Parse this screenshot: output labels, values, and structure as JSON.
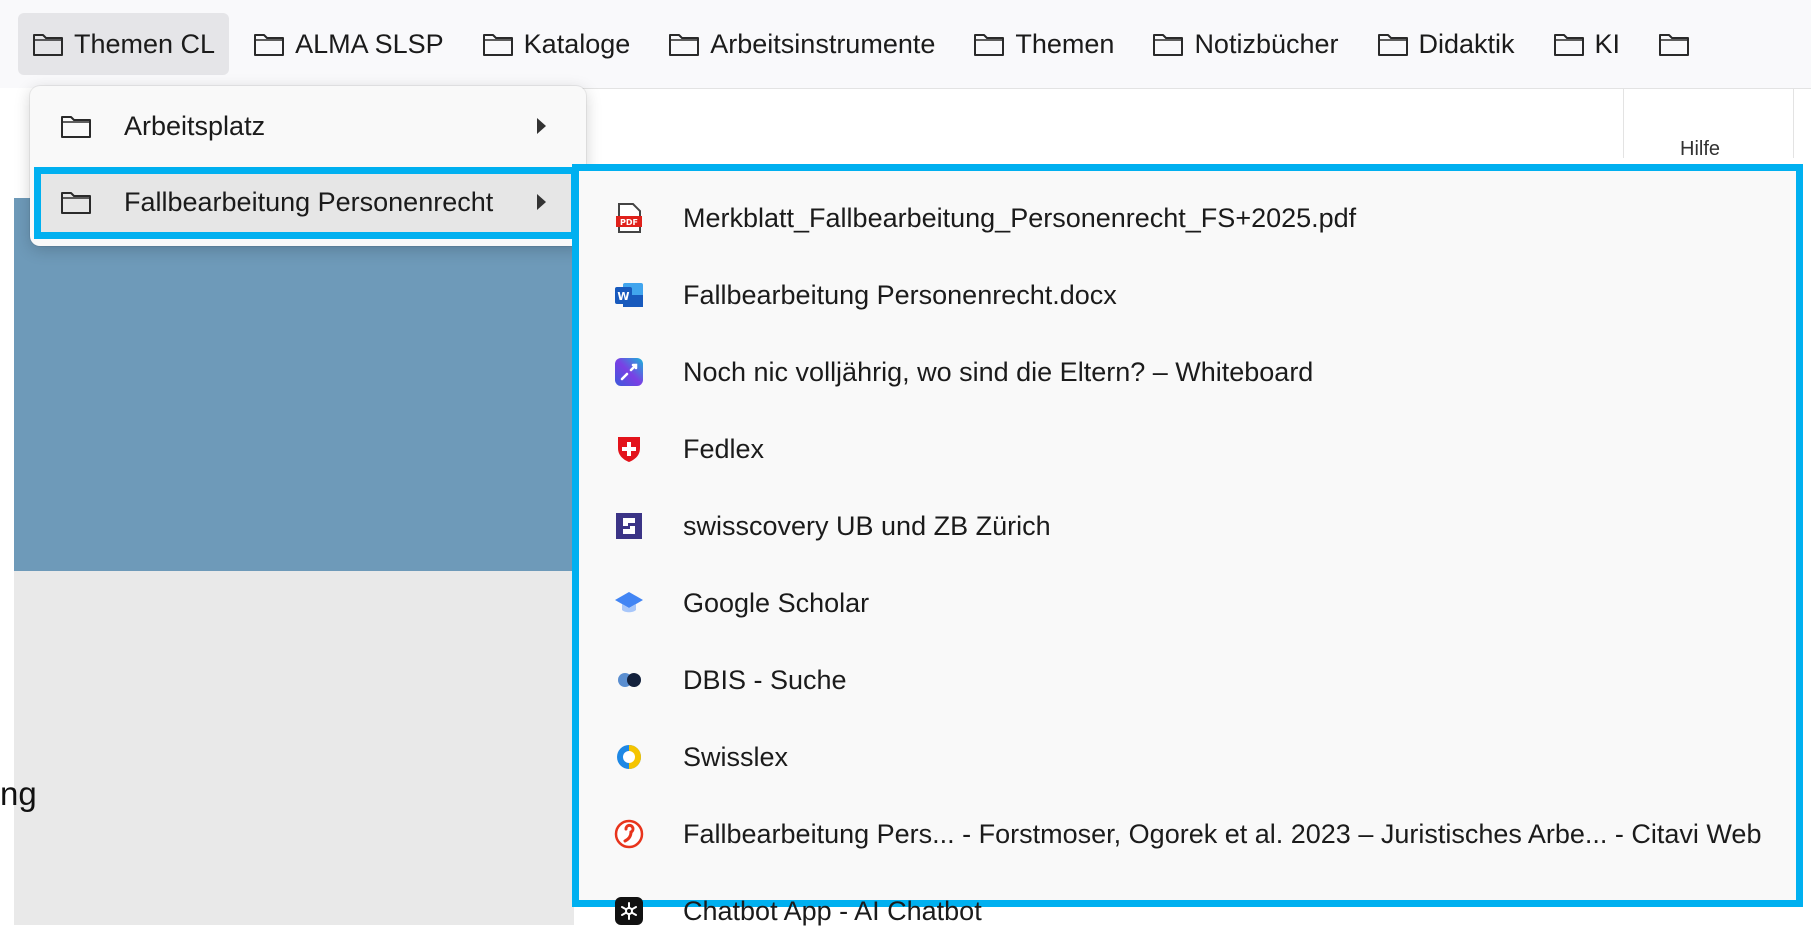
{
  "bookmarks_bar": {
    "items": [
      {
        "label": "Themen CL",
        "active": true
      },
      {
        "label": "ALMA SLSP"
      },
      {
        "label": "Kataloge"
      },
      {
        "label": "Arbeitsinstrumente"
      },
      {
        "label": "Themen"
      },
      {
        "label": "Notizbücher"
      },
      {
        "label": "Didaktik"
      },
      {
        "label": "KI"
      }
    ]
  },
  "page": {
    "hilfe_label": "Hilfe",
    "partial_text": "ng"
  },
  "folder_menu": {
    "items": [
      {
        "label": "Arbeitsplatz",
        "icon": "folder-icon",
        "has_submenu": true
      },
      {
        "label": "Fallbearbeitung Personenrecht",
        "icon": "folder-icon",
        "has_submenu": true,
        "highlighted": true
      }
    ]
  },
  "submenu": {
    "items": [
      {
        "label": "Merkblatt_Fallbearbeitung_Personenrecht_FS+2025.pdf",
        "icon": "pdf-icon"
      },
      {
        "label": "Fallbearbeitung Personenrecht.docx",
        "icon": "word-icon"
      },
      {
        "label": "Noch nic volljährig, wo sind die Eltern? – Whiteboard",
        "icon": "whiteboard-icon"
      },
      {
        "label": "Fedlex",
        "icon": "swiss-shield-icon"
      },
      {
        "label": "swisscovery UB und ZB Zürich",
        "icon": "swisscovery-icon"
      },
      {
        "label": "Google Scholar",
        "icon": "scholar-cap-icon"
      },
      {
        "label": "DBIS - Suche",
        "icon": "dbis-icon"
      },
      {
        "label": "Swisslex",
        "icon": "swisslex-icon"
      },
      {
        "label": "Fallbearbeitung Pers... - Forstmoser, Ogorek et al. 2023 – Juristisches Arbe... - Citavi Web",
        "icon": "citavi-icon"
      },
      {
        "label": "Chatbot App - AI Chatbot",
        "icon": "chatbot-icon"
      }
    ]
  },
  "colors": {
    "highlight": "#00b0f0",
    "page_blue": "#6e9ab9"
  }
}
